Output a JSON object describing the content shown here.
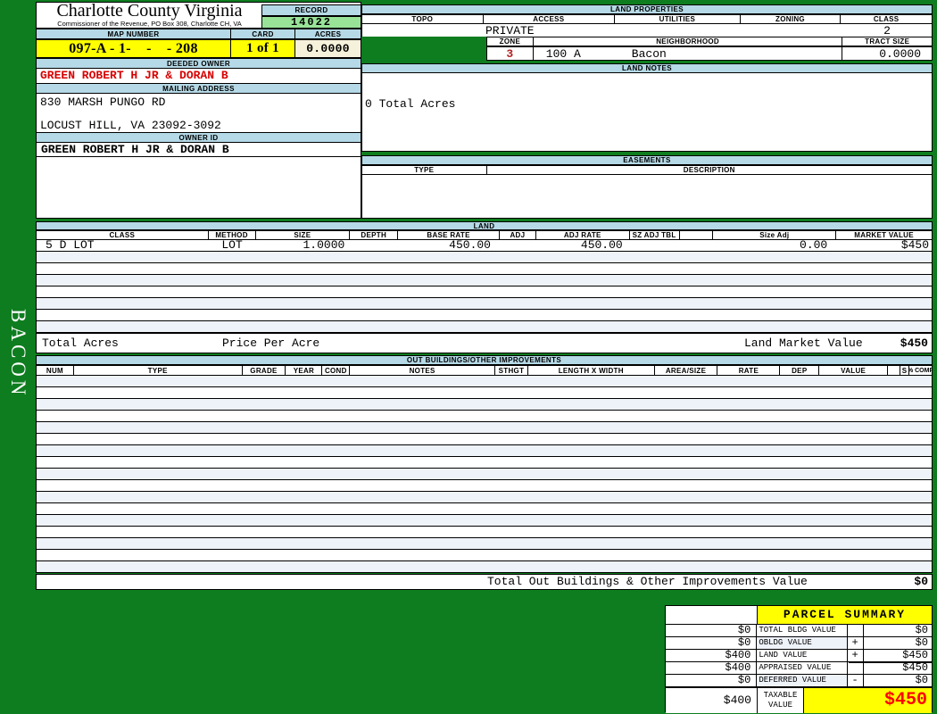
{
  "page": {
    "sidebar_text": "BACON"
  },
  "header": {
    "county_title": "Charlotte County Virginia",
    "county_subtitle": "Commissioner of the Revenue, PO Box 308, Charlotte CH, VA",
    "record_label": "RECORD",
    "record_value": "14022",
    "map_number_label": "MAP NUMBER",
    "map_number_value": "097-A - 1-    -    - 208",
    "card_label": "CARD",
    "card_value": "1 of 1",
    "acres_label": "ACRES",
    "acres_value": "0.0000"
  },
  "owner": {
    "deeded_owner_label": "DEEDED OWNER",
    "deeded_owner": "GREEN ROBERT H JR & DORAN B",
    "mailing_address_label": "MAILING ADDRESS",
    "address_line1": "830 MARSH PUNGO RD",
    "address_line2": "LOCUST HILL, VA 23092-3092",
    "owner_id_label": "OWNER ID",
    "owner_id": "GREEN ROBERT H JR & DORAN B"
  },
  "land_properties": {
    "section_label": "LAND PROPERTIES",
    "columns": [
      "TOPO",
      "ACCESS",
      "UTILITIES",
      "ZONING",
      "CLASS"
    ],
    "access_value": "PRIVATE",
    "class_value": "2",
    "zone_label": "ZONE",
    "zone_value": "3",
    "neighborhood_label": "NEIGHBORHOOD",
    "neighborhood_code": "100 A",
    "neighborhood_name": "Bacon",
    "tract_size_label": "TRACT SIZE",
    "tract_size_value": "0.0000"
  },
  "land_notes": {
    "section_label": "LAND NOTES",
    "note": "0 Total Acres"
  },
  "easements": {
    "section_label": "EASEMENTS",
    "type_label": "TYPE",
    "description_label": "DESCRIPTION"
  },
  "land_table": {
    "section_label": "LAND",
    "columns": [
      "CLASS",
      "METHOD",
      "SIZE",
      "DEPTH",
      "BASE RATE",
      "ADJ",
      "ADJ RATE",
      "SZ ADJ TBL",
      "",
      "Size Adj",
      "MARKET VALUE"
    ],
    "rows": [
      [
        "5 D LOT",
        "LOT",
        "1.0000",
        "",
        "450.00",
        "",
        "450.00",
        "",
        "",
        "0.00",
        "$450"
      ]
    ],
    "empty_row_count": 7,
    "total_acres_label": "Total Acres",
    "price_per_acre_label": "Price Per Acre",
    "land_market_value_label": "Land Market Value",
    "land_market_value": "$450"
  },
  "out_buildings": {
    "section_label": "OUT BUILDINGS/OTHER IMPROVEMENTS",
    "columns": [
      "NUM",
      "TYPE",
      "GRADE",
      "YEAR",
      "COND",
      "NOTES",
      "STHGT",
      "LENGTH X WIDTH",
      "AREA/SIZE",
      "RATE",
      "DEP",
      "VALUE",
      "",
      "S",
      "% COMP"
    ],
    "empty_row_count": 17,
    "total_label": "Total Out Buildings & Other Improvements Value",
    "total_value": "$0"
  },
  "parcel_summary": {
    "title": "PARCEL SUMMARY",
    "rows": [
      {
        "prior": "$0",
        "label": "TOTAL BLDG VALUE",
        "op": "",
        "value": "$0"
      },
      {
        "prior": "$0",
        "label": "OBLDG VALUE",
        "op": "+",
        "value": "$0"
      },
      {
        "prior": "$400",
        "label": "LAND VALUE",
        "op": "+",
        "value": "$450"
      },
      {
        "prior": "$400",
        "label": "APPRAISED VALUE",
        "op": "",
        "value": "$450"
      },
      {
        "prior": "$0",
        "label": "DEFERRED VALUE",
        "op": "-",
        "value": "$0"
      }
    ],
    "taxable": {
      "prior": "$400",
      "label_line1": "TAXABLE",
      "label_line2": "VALUE",
      "value": "$450"
    }
  },
  "colors": {
    "page_bg": "#0e7d1f",
    "header_band": "#b5d9e6",
    "record_green": "#99e399",
    "highlight_yellow": "#ffff00",
    "acres_cream": "#f5f1da",
    "owner_red": "#d80000",
    "taxable_red": "#ff0000",
    "row_tint": "#eef2f9"
  }
}
